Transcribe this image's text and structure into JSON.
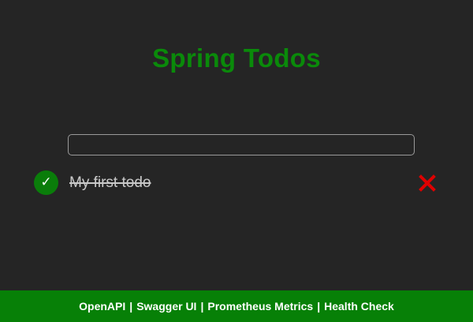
{
  "app": {
    "title": "Spring Todos"
  },
  "new_todo": {
    "value": "",
    "placeholder": ""
  },
  "todos": [
    {
      "text": "My first todo",
      "completed": true,
      "check_icon": "checkmark-icon",
      "delete_icon": "close-icon"
    }
  ],
  "footer": {
    "links": [
      "OpenAPI",
      "Swagger UI",
      "Prometheus Metrics",
      "Health Check"
    ],
    "separator": "|"
  },
  "colors": {
    "background": "#252525",
    "accent_green": "#0a8a0a",
    "footer_green": "#078007",
    "delete_red": "#e00000"
  }
}
